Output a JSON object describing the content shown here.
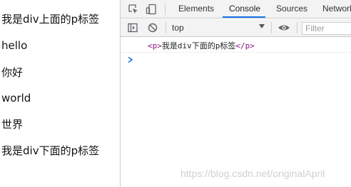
{
  "page": {
    "paragraphs": [
      "我是div上面的p标签",
      "hello",
      "你好",
      "world",
      "世界",
      "我是div下面的p标签"
    ]
  },
  "devtools": {
    "tabs": [
      "Elements",
      "Console",
      "Sources",
      "Network"
    ],
    "active_tab": "Console",
    "context": "top",
    "filter_placeholder": "Filter",
    "log": {
      "open_tag": "<p>",
      "text": "我是div下面的p标签",
      "close_tag": "</p>"
    }
  },
  "watermark": "https://blog.csdn.net/originalApril",
  "colors": {
    "active_tab_underline": "#1a73e8",
    "tag_color": "#881280",
    "prompt_color": "#1a73e8"
  }
}
